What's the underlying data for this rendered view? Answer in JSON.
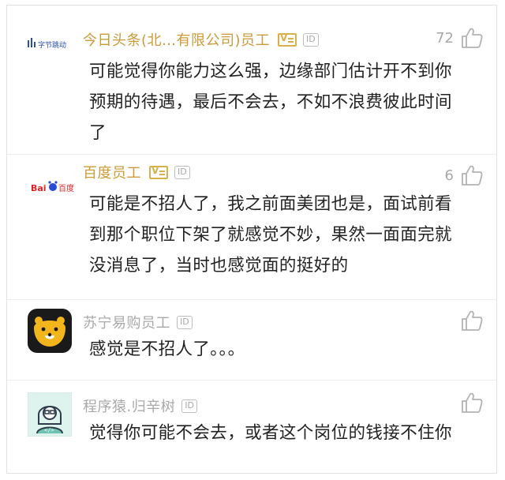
{
  "comments": [
    {
      "author": "今日头条(北…有限公司)员工",
      "verified": true,
      "id_badge": "ID",
      "likes": "72",
      "avatar_text": "字节跳动",
      "avatar_icon": "bytedance-logo",
      "text": "可能觉得你能力这么强，边缘部门估计开不到你预期的待遇，最后不会去，不如不浪费彼此时间了"
    },
    {
      "author": "百度员工",
      "verified": true,
      "id_badge": "ID",
      "likes": "6",
      "avatar_text_left": "Bai",
      "avatar_text_right": "百度",
      "avatar_icon": "baidu-logo",
      "text": "可能是不招人了，我之前面美团也是，面试前看到那个职位下架了就感觉不妙，果然一面面完就没消息了，当时也感觉面的挺好的"
    },
    {
      "author": "苏宁易购员工",
      "verified": false,
      "id_badge": "ID",
      "likes": "",
      "avatar_icon": "suning-lion-logo",
      "text": "感觉是不招人了。。。"
    },
    {
      "author": "程序猿.归辛树",
      "verified": false,
      "id_badge": "ID",
      "likes": "",
      "avatar_icon": "programmer-avatar",
      "text": "觉得你可能不会去，或者这个岗位的钱接不住你"
    }
  ],
  "colors": {
    "verified_name": "#cc9a3a",
    "plain_name": "#a9a9a9",
    "body_text": "#222222",
    "suning_bg": "#1a1a1a",
    "suning_face": "#f2b51c"
  }
}
